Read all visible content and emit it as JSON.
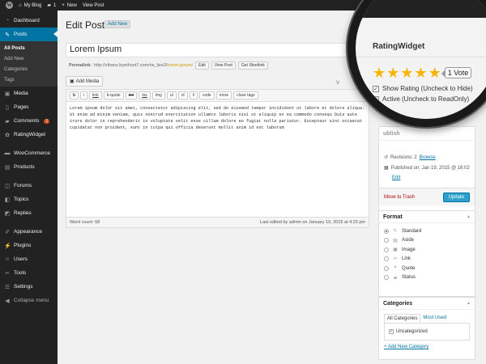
{
  "adminbar": {
    "site": "My Blog",
    "comments": "1",
    "new": "New",
    "view_post": "View Post",
    "user": "min"
  },
  "sidebar": {
    "items": [
      {
        "label": "Dashboard",
        "icon": "dashboard-icon"
      },
      {
        "label": "Posts",
        "icon": "pin-icon"
      },
      {
        "label": "Media",
        "icon": "media-icon"
      },
      {
        "label": "Pages",
        "icon": "page-icon"
      },
      {
        "label": "Comments",
        "icon": "comment-icon",
        "badge": "1"
      },
      {
        "label": "RatingWidget",
        "icon": "rating-icon"
      },
      {
        "label": "WooCommerce",
        "icon": "woocommerce-icon"
      },
      {
        "label": "Products",
        "icon": "products-icon"
      },
      {
        "label": "Forums",
        "icon": "forums-icon"
      },
      {
        "label": "Topics",
        "icon": "topics-icon"
      },
      {
        "label": "Replies",
        "icon": "replies-icon"
      },
      {
        "label": "Appearance",
        "icon": "appearance-icon"
      },
      {
        "label": "Plugins",
        "icon": "plugins-icon"
      },
      {
        "label": "Users",
        "icon": "users-icon"
      },
      {
        "label": "Tools",
        "icon": "tools-icon"
      },
      {
        "label": "Settings",
        "icon": "settings-icon"
      },
      {
        "label": "Collapse menu",
        "icon": "collapse-icon"
      }
    ],
    "submenu": [
      "All Posts",
      "Add New",
      "Categories",
      "Tags"
    ]
  },
  "page": {
    "title": "Edit Post",
    "add_new": "Add New",
    "post_title": "Lorem Ipsum",
    "permalink_label": "Permalink:",
    "permalink_base": "http://vihanz.byethost7.com/rw_live2/",
    "permalink_slug": "lorem-ipsum/",
    "edit": "Edit",
    "view_post": "View Post",
    "get_shortlink": "Get Shortlink",
    "add_media": "Add Media",
    "visual_tab": "V"
  },
  "editor": {
    "quicktags": [
      "b",
      "i",
      "link",
      "b-quote",
      "del",
      "ins",
      "img",
      "ul",
      "ol",
      "li",
      "code",
      "more",
      "close tags"
    ],
    "content": "Lorem ipsum dolor sit amet, consectetur adipiscing elit, sed do eiusmod tempor incididunt ut labore et dolore aliqua. Ut enim ad minim veniam, quis nostrud exercitation ullamco laboris nisi ut aliquip ex ea commodo consequ Duis aute irure dolor in reprehenderit in voluptate velit esse cillum dolore eu fugiat nulla pariatur. Excepteur sint occaecat cupidatat non proident, sunt in culpa qui officia deserunt mollit anim id est laborum",
    "word_count": "Word count: 68",
    "last_edited": "Last edited by admin on January 19, 2015 at 4:23 pm"
  },
  "publish": {
    "title": "ublish",
    "revisions_label": "Revisions: 2",
    "browse": "Browse",
    "published_on": "Published on: Jan 19, 2015 @ 16:02",
    "edit": "Edit",
    "trash": "Move to Trash",
    "update": "Update",
    "vis_fragment": "Vi"
  },
  "format": {
    "title": "Format",
    "options": [
      {
        "label": "Standard",
        "icon": "pin-icon",
        "checked": true
      },
      {
        "label": "Aside",
        "icon": "aside-icon",
        "checked": false
      },
      {
        "label": "Image",
        "icon": "image-icon",
        "checked": false
      },
      {
        "label": "Link",
        "icon": "link-icon",
        "checked": false
      },
      {
        "label": "Quote",
        "icon": "quote-icon",
        "checked": false
      },
      {
        "label": "Status",
        "icon": "status-icon",
        "checked": false
      }
    ]
  },
  "categories": {
    "title": "Categories",
    "tab_all": "All Categories",
    "tab_used": "Most Used",
    "item": "Uncategorized",
    "add_new": "+ Add New Category"
  },
  "rating_widget": {
    "title": "RatingWidget",
    "stars": 5,
    "votes": "1 Vote",
    "show_rating": "Show Rating (Uncheck to Hide)",
    "active": "Active (Uncheck to ReadOnly)"
  },
  "colors": {
    "accent": "#0074a2",
    "adminbar": "#222222",
    "star": "#f7b500",
    "badge": "#d54e21",
    "update_button": "#2ea2cc"
  }
}
